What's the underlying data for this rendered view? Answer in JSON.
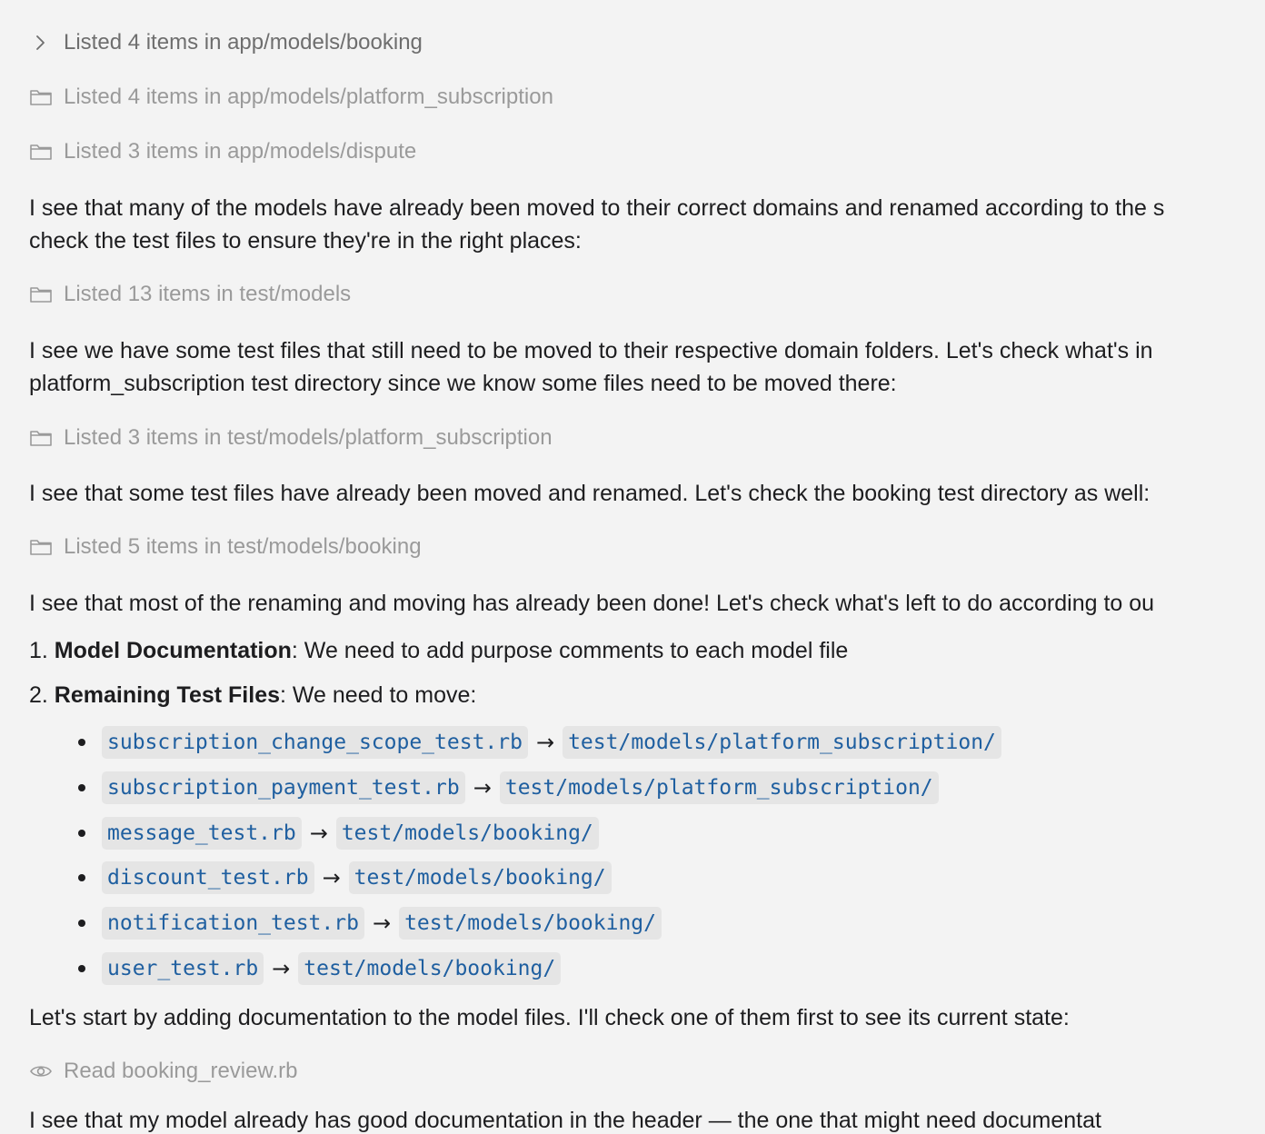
{
  "tool_calls": [
    {
      "icon": "chevron-right-icon",
      "label": "Listed 4 items in app/models/booking",
      "expanded": true
    },
    {
      "icon": "folder-icon",
      "label": "Listed 4 items in app/models/platform_subscription"
    },
    {
      "icon": "folder-icon",
      "label": "Listed 3 items in app/models/dispute"
    },
    {
      "icon": "folder-icon",
      "label": "Listed 13 items in test/models"
    },
    {
      "icon": "folder-icon",
      "label": "Listed 3 items in test/models/platform_subscription"
    },
    {
      "icon": "folder-icon",
      "label": "Listed 5 items in test/models/booking"
    },
    {
      "icon": "eye-icon",
      "label": "Read booking_review.rb"
    }
  ],
  "paragraphs": [
    {
      "lines": [
        "I see that many of the models have already been moved to their correct domains and renamed according to the s",
        "check the test files to ensure they're in the right places:"
      ]
    },
    {
      "lines": [
        "I see we have some test files that still need to be moved to their respective domain folders. Let's check what's in",
        "platform_subscription test directory since we know some files need to be moved there:"
      ]
    },
    {
      "lines": [
        "I see that some test files have already been moved and renamed. Let's check the booking test directory as well:"
      ]
    },
    {
      "lines": [
        "I see that most of the renaming and moving has already been done! Let's check what's left to do according to ou"
      ]
    },
    {
      "lines": [
        "Let's start by adding documentation to the model files. I'll check one of them first to see its current state:"
      ]
    }
  ],
  "numbered_list": [
    {
      "number": "1.",
      "bold": "Model Documentation",
      "rest": ": We need to add purpose comments to each model file"
    },
    {
      "number": "2.",
      "bold": "Remaining Test Files",
      "rest": ": We need to move:"
    }
  ],
  "moves": [
    {
      "from": "subscription_change_scope_test.rb",
      "arrow": "→",
      "to": "test/models/platform_subscription/"
    },
    {
      "from": "subscription_payment_test.rb",
      "arrow": "→",
      "to": "test/models/platform_subscription/"
    },
    {
      "from": "message_test.rb",
      "arrow": "→",
      "to": "test/models/booking/"
    },
    {
      "from": "discount_test.rb",
      "arrow": "→",
      "to": "test/models/booking/"
    },
    {
      "from": "notification_test.rb",
      "arrow": "→",
      "to": "test/models/booking/"
    },
    {
      "from": "user_test.rb",
      "arrow": "→",
      "to": "test/models/booking/"
    }
  ],
  "trailing_fragment": "I see that my model already has good documentation in the header — the one that might need documentat",
  "colors": {
    "background": "#f3f3f3",
    "text": "#1d1d1f",
    "muted": "#9a9a9a",
    "code_text": "#1f5fa0",
    "code_bg": "#e5e5e5"
  }
}
